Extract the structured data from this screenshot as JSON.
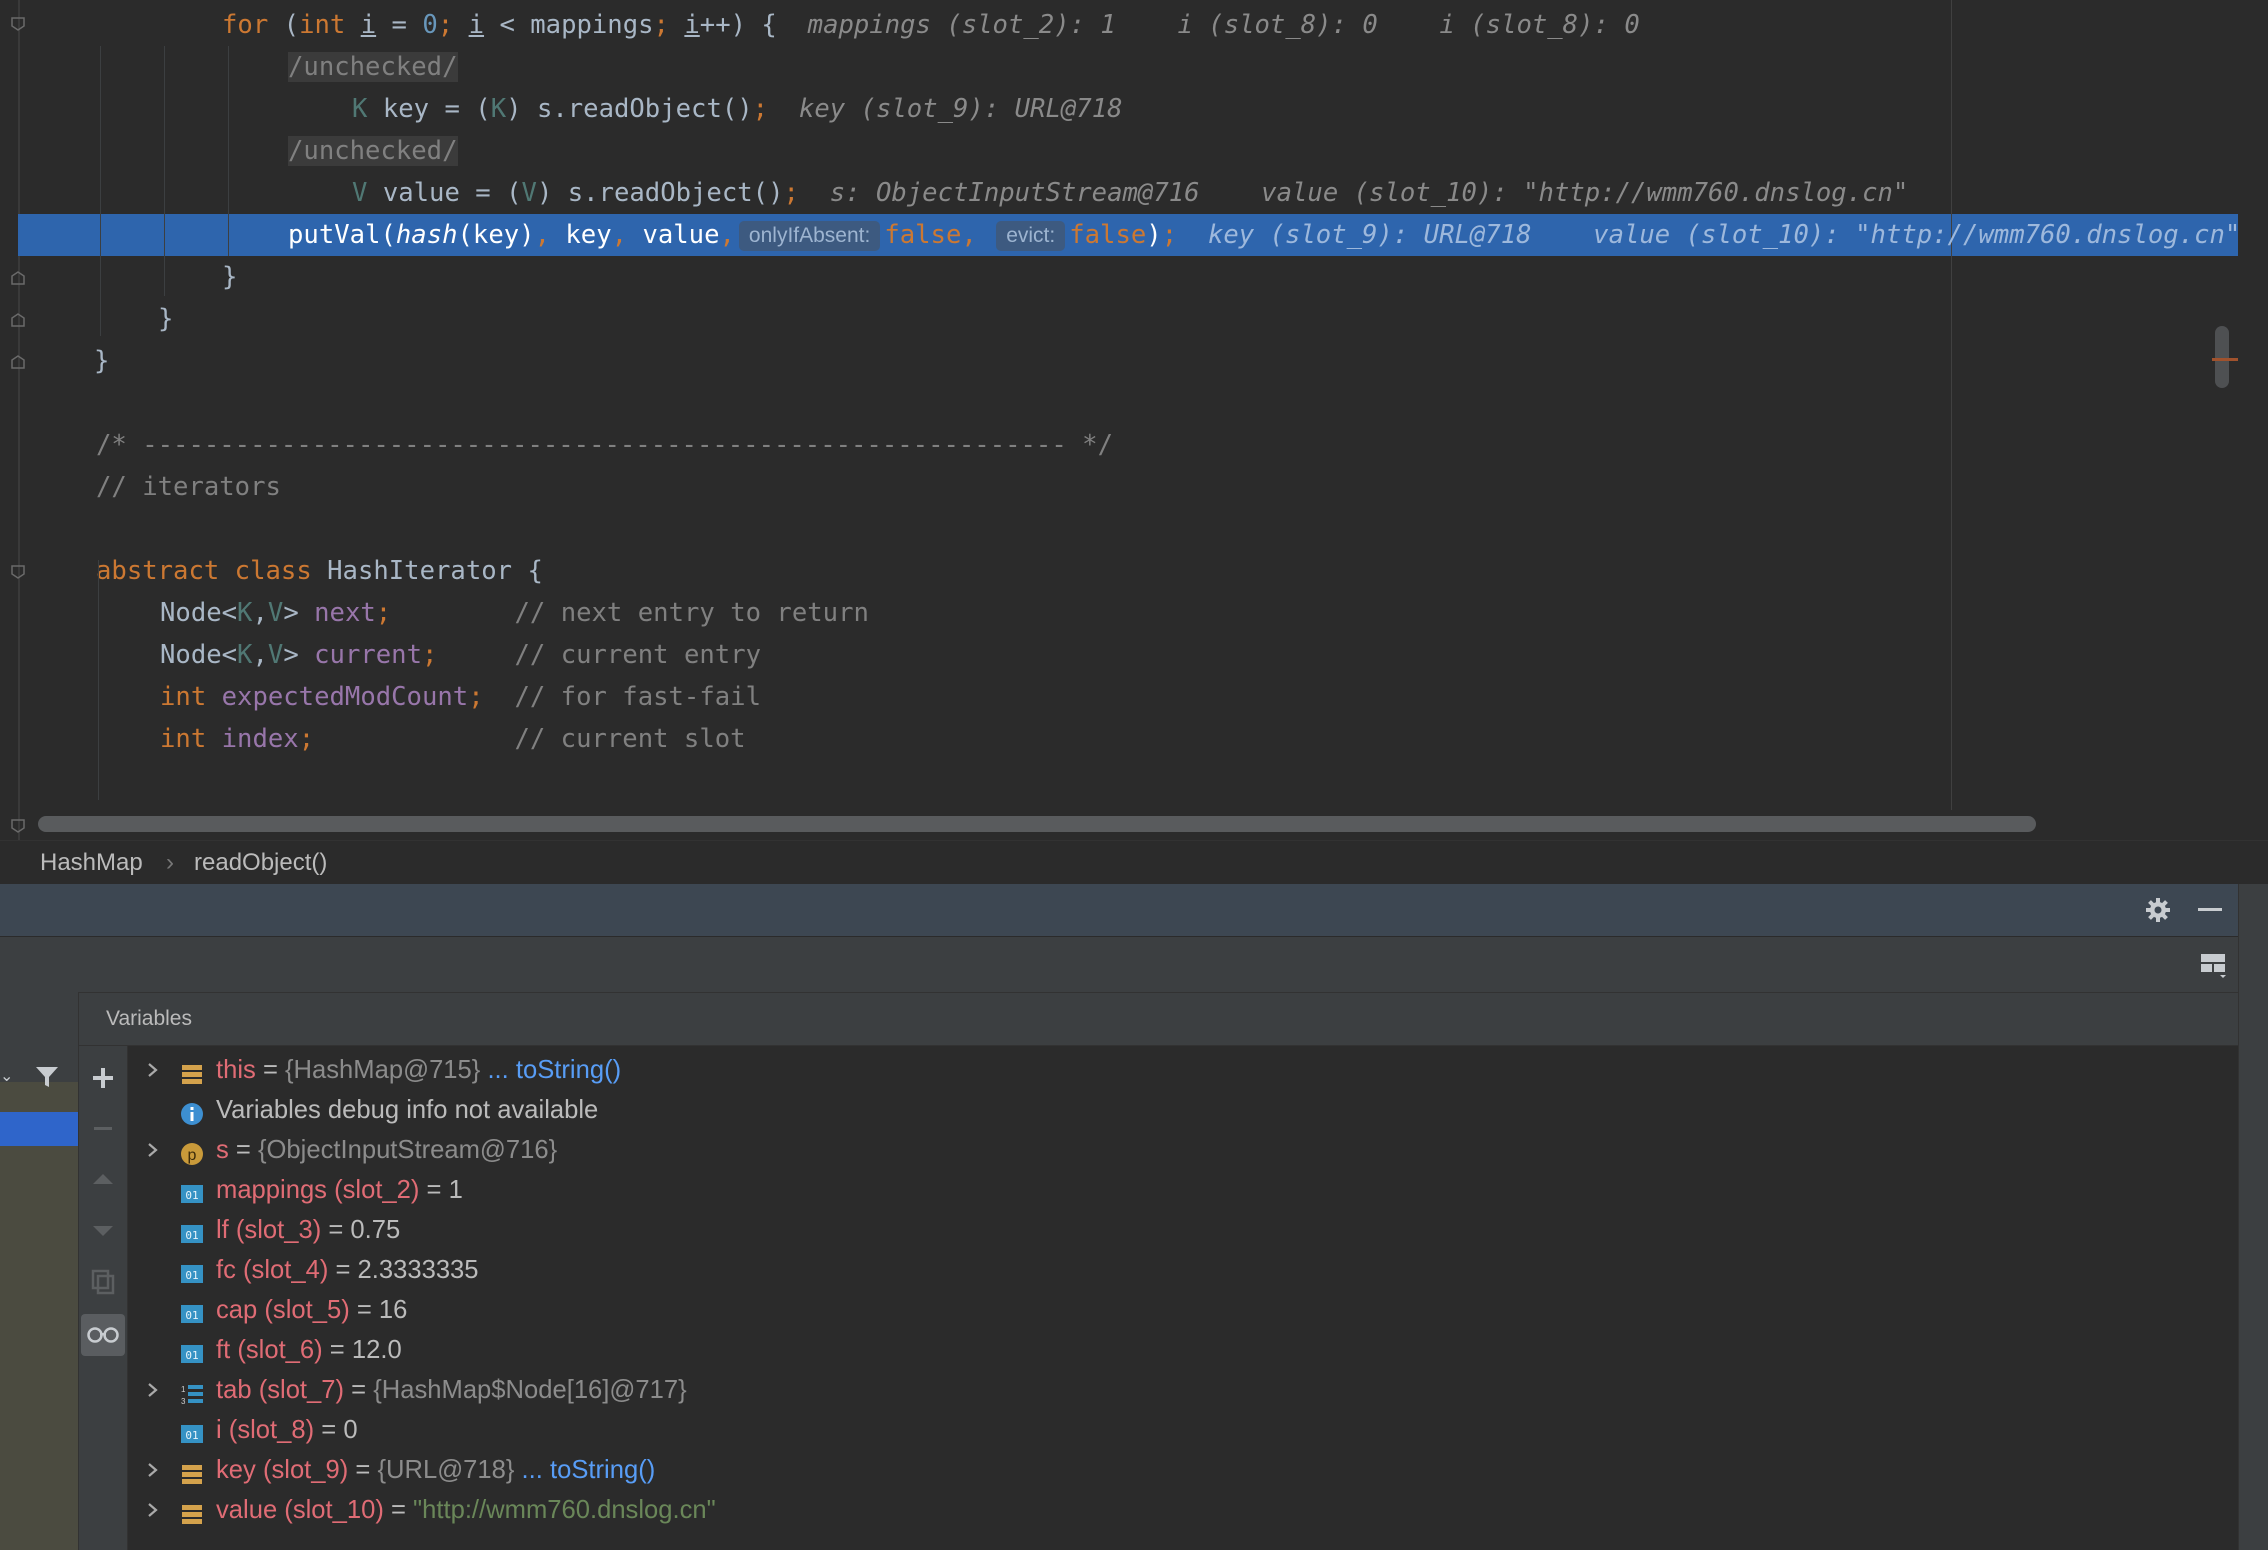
{
  "editor": {
    "code_lines": [
      {
        "id": "for",
        "tokens": [
          [
            "kw",
            "for"
          ],
          [
            "txt",
            " ("
          ],
          [
            "kw",
            "int "
          ],
          [
            "u",
            "i"
          ],
          [
            "txt",
            " = "
          ],
          [
            "num",
            "0"
          ],
          [
            "kw",
            "; "
          ],
          [
            "u",
            "i"
          ],
          [
            "txt",
            " < mappings"
          ],
          [
            "kw",
            "; "
          ],
          [
            "u",
            "i"
          ],
          [
            "txt",
            "++) {  "
          ],
          [
            "iv",
            "mappings (slot_2): 1    i (slot_8): 0    i (slot_8): 0"
          ]
        ]
      },
      {
        "id": "unchecked1",
        "tokens": [
          [
            "ann",
            "/unchecked/"
          ]
        ]
      },
      {
        "id": "key",
        "tokens": [
          [
            "gen",
            "K"
          ],
          [
            "txt",
            " key = ("
          ],
          [
            "gen",
            "K"
          ],
          [
            "txt",
            ") s.readObject()"
          ],
          [
            "kw",
            ";"
          ],
          [
            "txt",
            "  "
          ],
          [
            "iv",
            "key (slot_9): URL@718"
          ]
        ]
      },
      {
        "id": "unchecked2",
        "tokens": [
          [
            "ann",
            "/unchecked/"
          ]
        ]
      },
      {
        "id": "value",
        "tokens": [
          [
            "gen",
            "V"
          ],
          [
            "txt",
            " value = ("
          ],
          [
            "gen",
            "V"
          ],
          [
            "txt",
            ") s.readObject()"
          ],
          [
            "kw",
            ";"
          ],
          [
            "txt",
            "  "
          ],
          [
            "iv",
            "s: ObjectInputStream@716    value (slot_10): \"http://wmm760.dnslog.cn\""
          ]
        ]
      },
      {
        "id": "putval",
        "tokens": [
          [
            "txt",
            "putVal("
          ],
          [
            "it",
            "hash"
          ],
          [
            "txt",
            "(key)"
          ],
          [
            "kw",
            ","
          ],
          [
            "txt",
            " key"
          ],
          [
            "kw",
            ","
          ],
          [
            "txt",
            " value"
          ],
          [
            "kw",
            ","
          ],
          [
            "hint",
            "onlyIfAbsent:"
          ],
          [
            "kw",
            "false,"
          ],
          [
            "txt",
            " "
          ],
          [
            "hint",
            "evict:"
          ],
          [
            "kw",
            "false"
          ],
          [
            "txt",
            ")"
          ],
          [
            "kw",
            ";"
          ],
          [
            "txt",
            "  "
          ],
          [
            "iv",
            "key (slot_9): URL@718    value (slot_10): \"http://wmm760.dnslog.cn\""
          ]
        ]
      },
      {
        "id": "close1",
        "tokens": [
          [
            "txt",
            "}"
          ]
        ]
      },
      {
        "id": "close2",
        "tokens": [
          [
            "txt",
            "}"
          ]
        ]
      },
      {
        "id": "close3",
        "tokens": [
          [
            "txt",
            "}"
          ]
        ]
      },
      {
        "id": "blank1",
        "tokens": []
      },
      {
        "id": "divider",
        "tokens": [
          [
            "cmt",
            "/* ------------------------------------------------------------ */"
          ]
        ]
      },
      {
        "id": "iter-cmt",
        "tokens": [
          [
            "cmt",
            "// iterators"
          ]
        ]
      },
      {
        "id": "blank2",
        "tokens": []
      },
      {
        "id": "class",
        "tokens": [
          [
            "kw",
            "abstract class "
          ],
          [
            "txt",
            "HashIterator {"
          ]
        ]
      },
      {
        "id": "next",
        "tokens": [
          [
            "txt",
            "Node<"
          ],
          [
            "gen",
            "K"
          ],
          [
            "txt",
            ","
          ],
          [
            "gen",
            "V"
          ],
          [
            "txt",
            "> "
          ],
          [
            "fld",
            "next"
          ],
          [
            "kw",
            ";"
          ],
          [
            "txt",
            "        "
          ],
          [
            "cmt",
            "// next entry to return"
          ]
        ]
      },
      {
        "id": "current",
        "tokens": [
          [
            "txt",
            "Node<"
          ],
          [
            "gen",
            "K"
          ],
          [
            "txt",
            ","
          ],
          [
            "gen",
            "V"
          ],
          [
            "txt",
            "> "
          ],
          [
            "fld",
            "current"
          ],
          [
            "kw",
            ";"
          ],
          [
            "txt",
            "     "
          ],
          [
            "cmt",
            "// current entry"
          ]
        ]
      },
      {
        "id": "expected",
        "tokens": [
          [
            "kw",
            "int "
          ],
          [
            "fld",
            "expectedModCount"
          ],
          [
            "kw",
            ";"
          ],
          [
            "txt",
            "  "
          ],
          [
            "cmt",
            "// for fast-fail"
          ]
        ]
      },
      {
        "id": "index",
        "tokens": [
          [
            "kw",
            "int "
          ],
          [
            "fld",
            "index"
          ],
          [
            "kw",
            ";"
          ],
          [
            "txt",
            "             "
          ],
          [
            "cmt",
            "// current slot"
          ]
        ]
      }
    ]
  },
  "breadcrumb": {
    "class_name": "HashMap",
    "separator": "›",
    "method": "readObject()"
  },
  "variables": {
    "title": "Variables",
    "rows": [
      {
        "expandable": true,
        "icon": "field-icon",
        "name": "this",
        "eq": " = ",
        "value": "{HashMap@715}",
        "value_kind": "ref",
        "link": "... toString()"
      },
      {
        "expandable": false,
        "icon": "info-icon",
        "name": "",
        "eq": "",
        "value": "Variables debug info not available",
        "value_kind": "info",
        "link": ""
      },
      {
        "expandable": true,
        "icon": "parameter-icon",
        "name": "s",
        "eq": " = ",
        "value": "{ObjectInputStream@716}",
        "value_kind": "ref",
        "link": ""
      },
      {
        "expandable": false,
        "icon": "primitive-icon",
        "name": "mappings (slot_2)",
        "eq": " = ",
        "value": "1",
        "value_kind": "val",
        "link": ""
      },
      {
        "expandable": false,
        "icon": "primitive-icon",
        "name": "lf (slot_3)",
        "eq": " = ",
        "value": "0.75",
        "value_kind": "val",
        "link": ""
      },
      {
        "expandable": false,
        "icon": "primitive-icon",
        "name": "fc (slot_4)",
        "eq": " = ",
        "value": "2.3333335",
        "value_kind": "val",
        "link": ""
      },
      {
        "expandable": false,
        "icon": "primitive-icon",
        "name": "cap (slot_5)",
        "eq": " = ",
        "value": "16",
        "value_kind": "val",
        "link": ""
      },
      {
        "expandable": false,
        "icon": "primitive-icon",
        "name": "ft (slot_6)",
        "eq": " = ",
        "value": "12.0",
        "value_kind": "val",
        "link": ""
      },
      {
        "expandable": true,
        "icon": "array-icon",
        "name": "tab (slot_7)",
        "eq": " = ",
        "value": "{HashMap$Node[16]@717}",
        "value_kind": "ref",
        "link": ""
      },
      {
        "expandable": false,
        "icon": "primitive-icon",
        "name": "i (slot_8)",
        "eq": " = ",
        "value": "0",
        "value_kind": "val",
        "link": ""
      },
      {
        "expandable": true,
        "icon": "field-icon",
        "name": "key (slot_9)",
        "eq": " = ",
        "value": "{URL@718}",
        "value_kind": "ref",
        "link": "... toString()"
      },
      {
        "expandable": true,
        "icon": "field-icon",
        "name": "value (slot_10)",
        "eq": " = ",
        "value": "\"http://wmm760.dnslog.cn\"",
        "value_kind": "str",
        "link": ""
      }
    ]
  },
  "colors": {
    "exec_line": "#2e65ad",
    "keyword": "#cc7832",
    "var_name": "#e06c75",
    "string": "#6a8759",
    "link": "#589df6"
  }
}
